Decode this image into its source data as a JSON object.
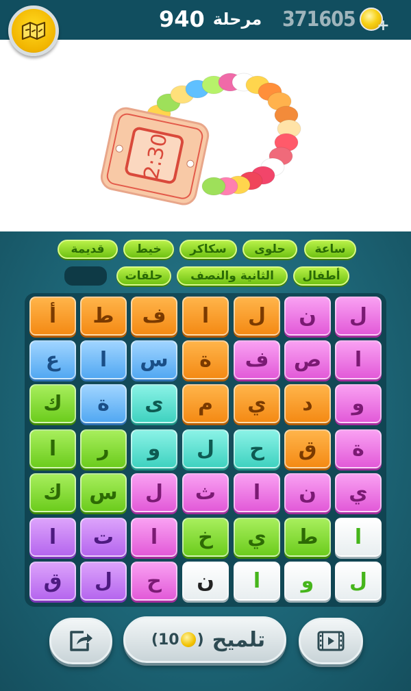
{
  "header": {
    "level_label": "مرحلة",
    "level_number": "940",
    "coins": "371605",
    "menu_icon": "map-icon",
    "coin_icon": "coin-icon",
    "plus_icon": "plus-icon"
  },
  "picture": {
    "subject": "candy-bracelet-watch",
    "watch_text": "2:30"
  },
  "words": [
    {
      "label": "ساعة"
    },
    {
      "label": "حلوى"
    },
    {
      "label": "سكاكر"
    },
    {
      "label": "خيط"
    },
    {
      "label": "قديمة"
    },
    {
      "label": "أطفال"
    },
    {
      "label": "الثانية والنصف"
    },
    {
      "label": "حلقات"
    }
  ],
  "grid": {
    "rows": [
      [
        {
          "l": "ل",
          "c": "pink"
        },
        {
          "l": "ن",
          "c": "pink"
        },
        {
          "l": "ل",
          "c": "orange"
        },
        {
          "l": "ا",
          "c": "orange"
        },
        {
          "l": "ف",
          "c": "orange"
        },
        {
          "l": "ط",
          "c": "orange"
        },
        {
          "l": "أ",
          "c": "orange"
        }
      ],
      [
        {
          "l": "ا",
          "c": "pink"
        },
        {
          "l": "ص",
          "c": "pink"
        },
        {
          "l": "ف",
          "c": "pink"
        },
        {
          "l": "ة",
          "c": "orange"
        },
        {
          "l": "س",
          "c": "blue"
        },
        {
          "l": "ا",
          "c": "blue"
        },
        {
          "l": "ع",
          "c": "blue"
        }
      ],
      [
        {
          "l": "و",
          "c": "pink"
        },
        {
          "l": "د",
          "c": "orange"
        },
        {
          "l": "ي",
          "c": "orange"
        },
        {
          "l": "م",
          "c": "orange"
        },
        {
          "l": "ى",
          "c": "teal"
        },
        {
          "l": "ة",
          "c": "blue"
        },
        {
          "l": "ك",
          "c": "green"
        }
      ],
      [
        {
          "l": "ة",
          "c": "pink"
        },
        {
          "l": "ق",
          "c": "orange"
        },
        {
          "l": "ح",
          "c": "teal"
        },
        {
          "l": "ل",
          "c": "teal"
        },
        {
          "l": "و",
          "c": "teal"
        },
        {
          "l": "ر",
          "c": "green"
        },
        {
          "l": "ا",
          "c": "green"
        }
      ],
      [
        {
          "l": "ي",
          "c": "pink"
        },
        {
          "l": "ن",
          "c": "pink"
        },
        {
          "l": "ا",
          "c": "pink"
        },
        {
          "l": "ث",
          "c": "pink"
        },
        {
          "l": "ل",
          "c": "pink"
        },
        {
          "l": "س",
          "c": "green"
        },
        {
          "l": "ك",
          "c": "green"
        }
      ],
      [
        {
          "l": "ا",
          "c": "white"
        },
        {
          "l": "ط",
          "c": "green"
        },
        {
          "l": "ي",
          "c": "green"
        },
        {
          "l": "خ",
          "c": "green"
        },
        {
          "l": "ا",
          "c": "pink"
        },
        {
          "l": "ت",
          "c": "purple"
        },
        {
          "l": "ا",
          "c": "purple"
        }
      ],
      [
        {
          "l": "ل",
          "c": "white"
        },
        {
          "l": "و",
          "c": "white"
        },
        {
          "l": "ا",
          "c": "white"
        },
        {
          "l": "ن",
          "c": "white-dark"
        },
        {
          "l": "ح",
          "c": "pink"
        },
        {
          "l": "ل",
          "c": "purple"
        },
        {
          "l": "ق",
          "c": "purple"
        }
      ]
    ]
  },
  "controls": {
    "hint_label": "تلميح",
    "hint_cost": "10",
    "share_icon": "share-icon",
    "video_icon": "video-icon"
  }
}
